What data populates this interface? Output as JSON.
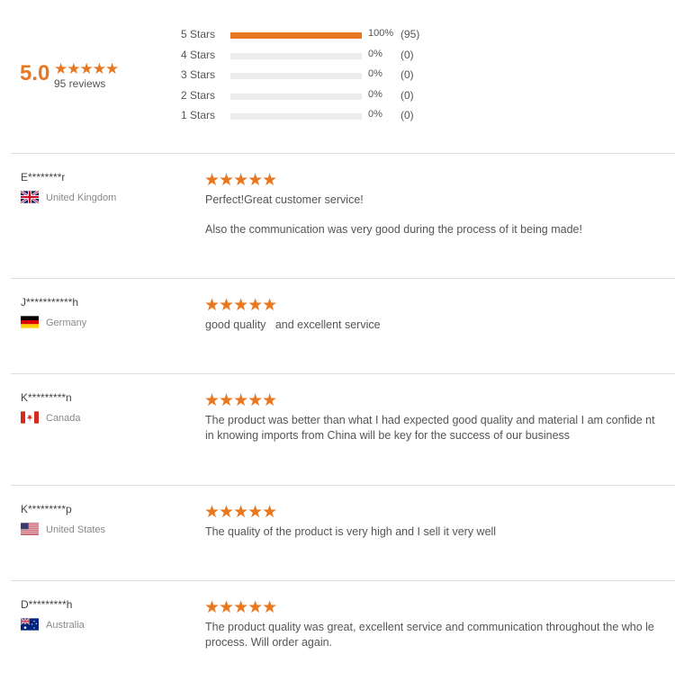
{
  "summary": {
    "average": "5.0",
    "stars": "★★★★★",
    "review_count": "95 reviews",
    "distribution": [
      {
        "label": "5 Stars",
        "percent_text": "100%",
        "count_text": "(95)",
        "fill_fraction": 1.0
      },
      {
        "label": "4 Stars",
        "percent_text": "0%",
        "count_text": "(0)",
        "fill_fraction": 0
      },
      {
        "label": "3 Stars",
        "percent_text": "0%",
        "count_text": "(0)",
        "fill_fraction": 0
      },
      {
        "label": "2 Stars",
        "percent_text": "0%",
        "count_text": "(0)",
        "fill_fraction": 0
      },
      {
        "label": "1 Stars",
        "percent_text": "0%",
        "count_text": "(0)",
        "fill_fraction": 0
      }
    ]
  },
  "colors": {
    "accent": "#e87722",
    "track": "#ececec",
    "divider": "#dddddd"
  },
  "reviews": [
    {
      "reviewer": "E********r",
      "country": "United Kingdom",
      "flag_icon": "uk-flag-icon",
      "rating": 5,
      "stars": "★★★★★",
      "text": "Perfect!Great customer service!",
      "text2": "Also the communication was very good during the process of it being made!"
    },
    {
      "reviewer": "J***********h",
      "country": "Germany",
      "flag_icon": "germany-flag-icon",
      "rating": 5,
      "stars": "★★★★★",
      "text": "good quality   and excellent service",
      "text2": ""
    },
    {
      "reviewer": "K*********n",
      "country": "Canada",
      "flag_icon": "canada-flag-icon",
      "rating": 5,
      "stars": "★★★★★",
      "text": "The product was better than what I had expected good quality and material I am confide nt in knowing imports from China will be key for the success of our business",
      "text2": ""
    },
    {
      "reviewer": "K*********p",
      "country": "United States",
      "flag_icon": "usa-flag-icon",
      "rating": 5,
      "stars": "★★★★★",
      "text": "The quality of the product is very high and I sell it very well",
      "text2": ""
    },
    {
      "reviewer": "D*********h",
      "country": "Australia",
      "flag_icon": "australia-flag-icon",
      "rating": 5,
      "stars": "★★★★★",
      "text": "The product quality was great, excellent service and communication throughout the who le process. Will order again.",
      "text2": ""
    }
  ]
}
